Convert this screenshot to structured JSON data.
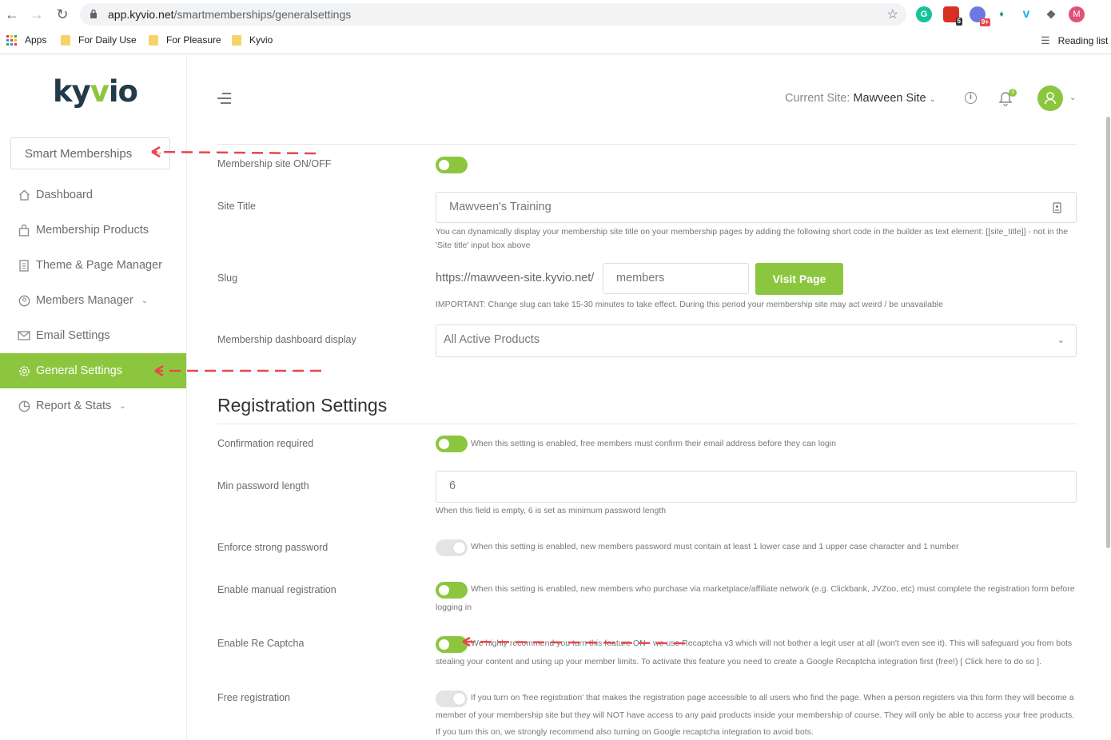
{
  "browser": {
    "url_host": "app.kyvio.net",
    "url_path": "/smartmemberships/generalsettings",
    "bookmarks": [
      "Apps",
      "For Daily Use",
      "For Pleasure",
      "Kyvio"
    ],
    "reading_list": "Reading list",
    "ext_badges": {
      "calendar": "5",
      "grid": "9+"
    },
    "profile_initial": "M"
  },
  "sidebar": {
    "logo_left": "ky",
    "logo_accent": "v",
    "logo_right": "io",
    "app_select": "Smart Memberships",
    "items": [
      {
        "label": "Dashboard",
        "icon": "home-icon"
      },
      {
        "label": "Membership Products",
        "icon": "bag-icon"
      },
      {
        "label": "Theme & Page Manager",
        "icon": "page-icon"
      },
      {
        "label": "Members Manager",
        "icon": "users-icon"
      },
      {
        "label": "Email Settings",
        "icon": "mail-icon"
      },
      {
        "label": "General Settings",
        "icon": "gear-icon"
      },
      {
        "label": "Report & Stats",
        "icon": "chart-icon"
      }
    ]
  },
  "header": {
    "current_site_label": "Current Site:",
    "current_site_value": "Mawveen Site",
    "notification_count": "3"
  },
  "settings": {
    "membership_site_label": "Membership site ON/OFF",
    "site_title_label": "Site Title",
    "site_title_value": "Mawveen's Training",
    "site_title_help_1": "You can dynamically display your membership site title on your membership pages by adding the following short code in the builder as text element: [[site_title]] - not in the",
    "site_title_help_2": "'Site title' input box above",
    "slug_label": "Slug",
    "slug_prefix": "https://mawveen-site.kyvio.net/",
    "slug_placeholder": "members",
    "visit_button": "Visit Page",
    "slug_help": "IMPORTANT: Change slug can take 15-30 minutes to take effect. During this period your membership site may act weird / be unavailable",
    "dashboard_display_label": "Membership dashboard display",
    "dashboard_display_value": "All Active Products"
  },
  "registration": {
    "title": "Registration Settings",
    "confirmation_label": "Confirmation required",
    "confirmation_help": "When this setting is enabled, free members must confirm their email address before they can login",
    "min_pw_label": "Min password length",
    "min_pw_value": "6",
    "min_pw_help": "When this field is empty, 6 is set as minimum password length",
    "strong_pw_label": "Enforce strong password",
    "strong_pw_help": "When this setting is enabled, new members password must contain at least 1 lower case and 1 upper case character and 1 number",
    "manual_reg_label": "Enable manual registration",
    "manual_reg_help_1": "When this setting is enabled, new members who purchase via marketplace/affiliate network (e.g. Clickbank, JVZoo, etc) must complete the registration form before",
    "manual_reg_help_2": "logging in",
    "recaptcha_label": "Enable Re Captcha",
    "recaptcha_help_1": "We highly recommend you turn this feature ON - we use Recaptcha v3 which will not bother a legit user at all (won't even see it). This will safeguard you from bots",
    "recaptcha_help_2": "stealing your content and using up your member limits. To activate this feature you need to create a Google Recaptcha integration first (free!) [ Click here to do so ].",
    "free_reg_label": "Free registration",
    "free_reg_help_1": "If you turn on 'free registration' that makes the registration page accessible to all users who find the page. When a person registers via this form they will become a",
    "free_reg_help_2": "member of your membership site but they will NOT have access to any paid products inside your membership of course. They will only be able to access your free products.",
    "free_reg_help_3": "If you turn this on, we strongly recommend also turning on Google recaptcha integration to avoid bots."
  },
  "colors": {
    "accent": "#8cc63f",
    "annotation": "#e8474c",
    "logo_dark": "#233a4a"
  }
}
